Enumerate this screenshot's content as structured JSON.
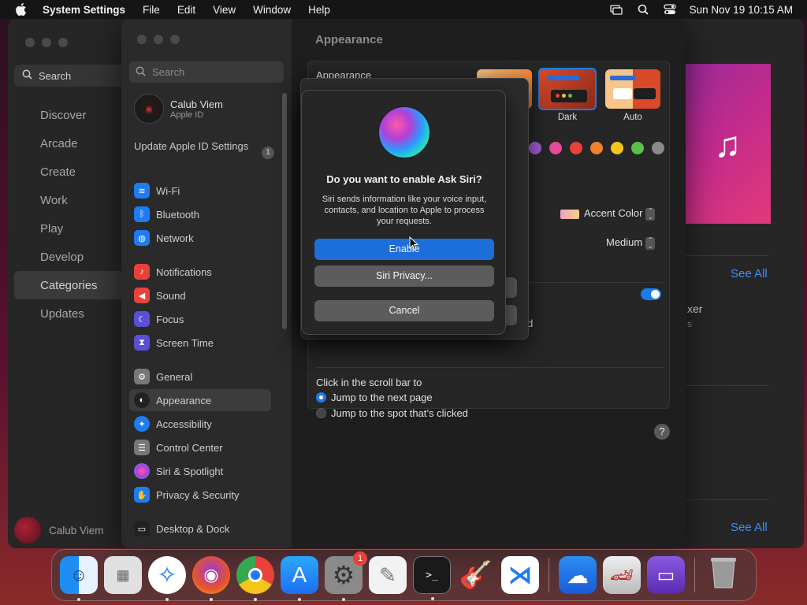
{
  "menubar": {
    "app_name": "System Settings",
    "items": [
      "File",
      "Edit",
      "View",
      "Window",
      "Help"
    ],
    "datetime": "Sun Nov 19  10:15 AM"
  },
  "store": {
    "search_placeholder": "Search",
    "nav": [
      "Discover",
      "Arcade",
      "Create",
      "Work",
      "Play",
      "Develop",
      "Categories",
      "Updates"
    ],
    "selected_nav": "Categories",
    "user_name": "Calub Viem",
    "see_all_1": "See All",
    "see_all_2": "See All",
    "partial_title": "xer",
    "partial_sub": "s"
  },
  "settings": {
    "search_placeholder": "Search",
    "profile": {
      "name": "Calub Viem",
      "sub": "Apple ID"
    },
    "update": {
      "label": "Update Apple ID Settings",
      "badge": "1"
    },
    "sidebar": [
      {
        "label": "Wi-Fi",
        "icon": "wifi-icon",
        "color": "#1e7cf2"
      },
      {
        "label": "Bluetooth",
        "icon": "bluetooth-icon",
        "color": "#1e7cf2"
      },
      {
        "label": "Network",
        "icon": "globe-icon",
        "color": "#1e7cf2"
      },
      {
        "label": "Notifications",
        "icon": "bell-icon",
        "color": "#e8423a"
      },
      {
        "label": "Sound",
        "icon": "speaker-icon",
        "color": "#e8423a"
      },
      {
        "label": "Focus",
        "icon": "moon-icon",
        "color": "#5a4fd6"
      },
      {
        "label": "Screen Time",
        "icon": "hourglass-icon",
        "color": "#5a4fd6"
      },
      {
        "label": "General",
        "icon": "gear-icon",
        "color": "#777777"
      },
      {
        "label": "Appearance",
        "icon": "appearance-icon",
        "color": "#222222"
      },
      {
        "label": "Accessibility",
        "icon": "accessibility-icon",
        "color": "#1e7cf2"
      },
      {
        "label": "Control Center",
        "icon": "control-center-icon",
        "color": "#777777"
      },
      {
        "label": "Siri & Spotlight",
        "icon": "siri-icon",
        "color": "#b23fd8"
      },
      {
        "label": "Privacy & Security",
        "icon": "hand-icon",
        "color": "#1e7cf2"
      },
      {
        "label": "Desktop & Dock",
        "icon": "dock-icon",
        "color": "#222222"
      }
    ],
    "selected": "Appearance",
    "main_title": "Appearance",
    "panel_label": "Appearance",
    "thumb_dark": "Dark",
    "thumb_auto": "Auto",
    "accent_colors": [
      "#a05ad0",
      "#e84a9a",
      "#e8423a",
      "#f0822a",
      "#f5c518",
      "#5ac24a",
      "#8a8a8a"
    ],
    "accent_label": "Accent Color",
    "medium_label": "Medium",
    "partial_d": "d",
    "scroll_label": "Click in the scroll bar to",
    "radio_1": "Jump to the next page",
    "radio_2": "Jump to the spot that’s clicked",
    "help": "?"
  },
  "dialog": {
    "title": "Do you want to enable Ask Siri?",
    "message": "Siri sends information like your voice input, contacts, and location to Apple to process your requests.",
    "enable": "Enable",
    "privacy": "Siri Privacy...",
    "cancel": "Cancel"
  },
  "dock": {
    "notification_badge": "1",
    "apps": [
      "Finder",
      "Launchpad",
      "Safari",
      "Firefox",
      "Chrome",
      "App Store",
      "System Settings",
      "TextEdit",
      "Terminal",
      "GarageBand",
      "Visual Studio Code",
      "Weather",
      "Asphalt",
      "Apple Configurator",
      "Trash"
    ]
  }
}
